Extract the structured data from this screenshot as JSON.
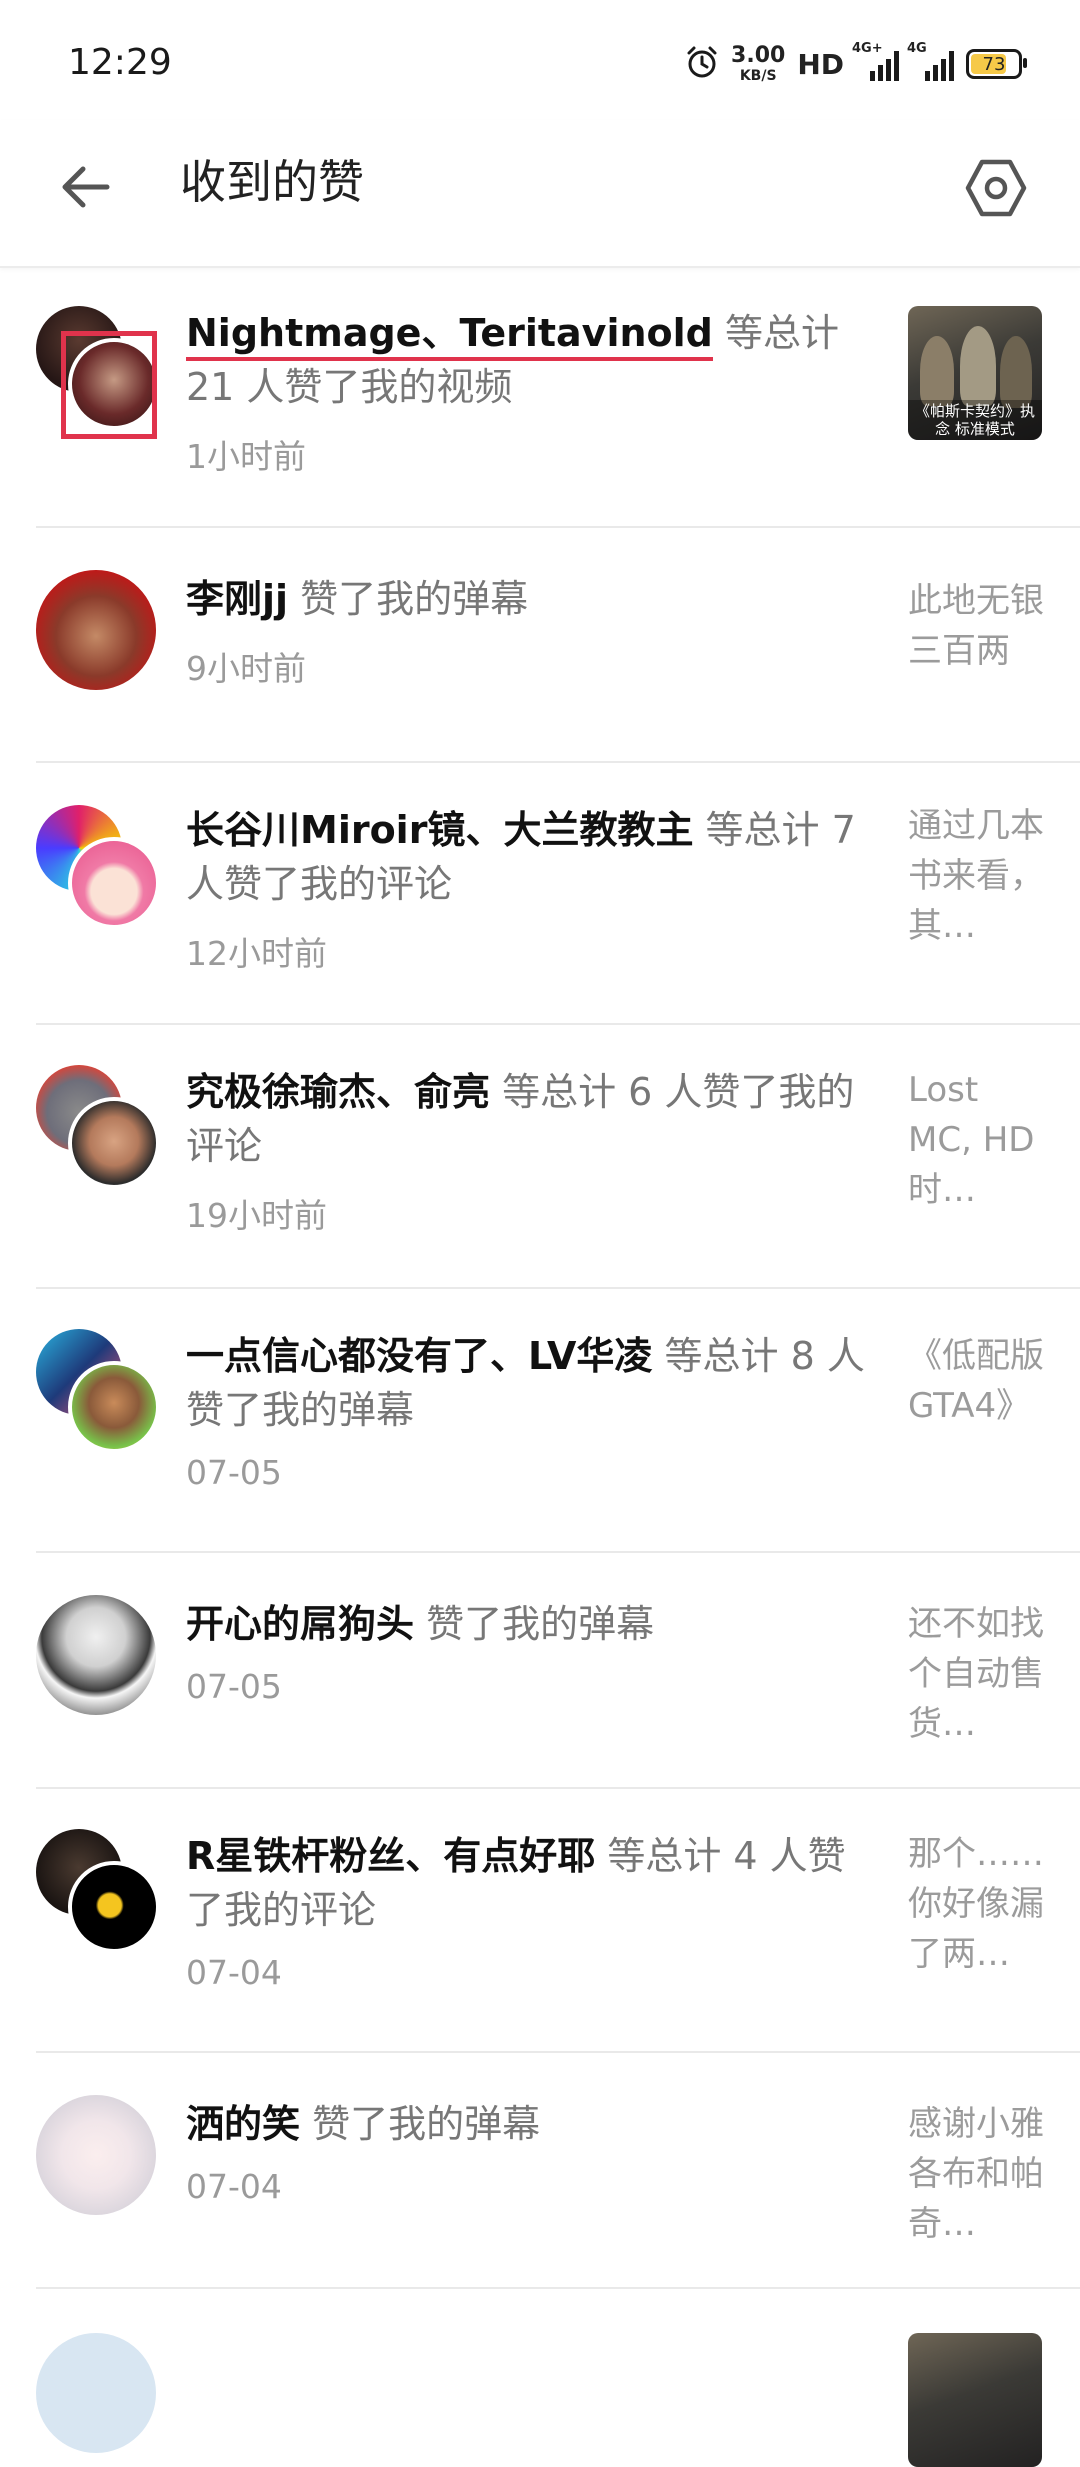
{
  "status_bar": {
    "time": "12:29",
    "net_speed_value": "3.00",
    "net_speed_unit": "KB/S",
    "hd": "HD",
    "signal1_label": "4G+",
    "signal2_label": "4G",
    "battery": "73"
  },
  "header": {
    "title": "收到的赞"
  },
  "items": [
    {
      "names": "Nightmage、Teritavinold",
      "action": " 等总计 21 人赞了我的视频",
      "time": "1小时前",
      "preview": "",
      "thumb_caption": "《帕斯卡契约》执念 标准模式"
    },
    {
      "names": "李刚jj",
      "action": " 赞了我的弹幕",
      "time": "9小时前",
      "preview": "此地无银三百两"
    },
    {
      "names": "长谷川Miroir镜、大兰教教主",
      "action": " 等总计 7 人赞了我的评论",
      "time": "12小时前",
      "preview": "通过几本书来看，其…"
    },
    {
      "names": "究极徐瑜杰、俞亮",
      "action": " 等总计 6 人赞了我的评论",
      "time": "19小时前",
      "preview": "Lost MC, HD时…"
    },
    {
      "names": "一点信心都没有了、LV华凌",
      "action": " 等总计 8 人赞了我的弹幕",
      "time": "07-05",
      "preview": "《低配版GTA4》"
    },
    {
      "names": "开心的屌狗头",
      "action": " 赞了我的弹幕",
      "time": "07-05",
      "preview": "还不如找个自动售货…"
    },
    {
      "names": "R星铁杆粉丝、有点好耶",
      "action": " 等总计 4 人赞了我的评论",
      "time": "07-04",
      "preview": "那个……你好像漏了两…"
    },
    {
      "names": "洒的笑",
      "action": " 赞了我的弹幕",
      "time": "07-04",
      "preview": "感谢小雅各布和帕奇…"
    }
  ],
  "colors": {
    "accent_red": "#e0334c",
    "muted_text": "#9a9a9a",
    "divider": "#e9e9e9"
  },
  "icons": {
    "back": "arrow-left-icon",
    "settings": "hexagon-gear-icon"
  }
}
